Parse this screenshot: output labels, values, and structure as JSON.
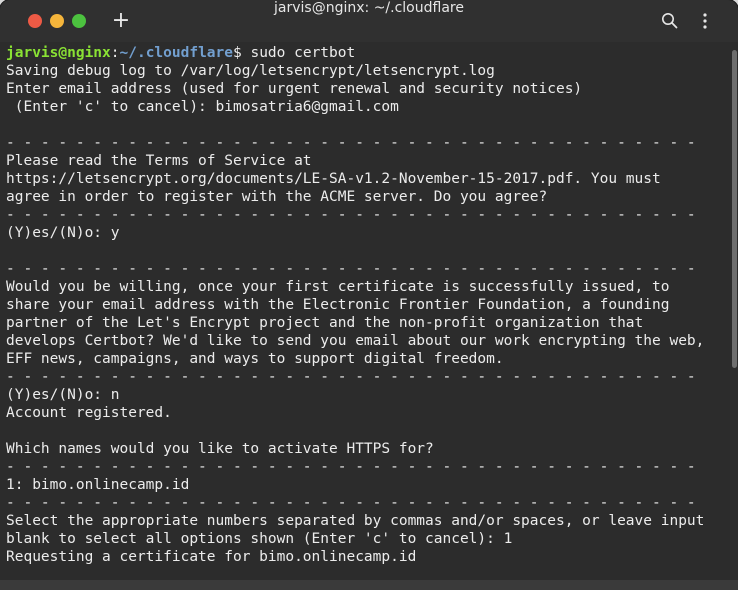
{
  "window": {
    "title": "jarvis@nginx: ~/.cloudflare",
    "new_tab_icon": "plus-icon",
    "search_icon": "search-icon",
    "menu_icon": "kebab-menu-icon"
  },
  "terminal": {
    "prompt_user": "jarvis@nginx",
    "prompt_sep": ":",
    "prompt_path": "~/.cloudflare",
    "prompt_end": "$ ",
    "command": "sudo certbot",
    "lines": [
      "Saving debug log to /var/log/letsencrypt/letsencrypt.log",
      "Enter email address (used for urgent renewal and security notices)",
      " (Enter 'c' to cancel): bimosatria6@gmail.com",
      "",
      "- - - - - - - - - - - - - - - - - - - - - - - - - - - - - - - - - - - - - - - -",
      "Please read the Terms of Service at",
      "https://letsencrypt.org/documents/LE-SA-v1.2-November-15-2017.pdf. You must",
      "agree in order to register with the ACME server. Do you agree?",
      "- - - - - - - - - - - - - - - - - - - - - - - - - - - - - - - - - - - - - - - -",
      "(Y)es/(N)o: y",
      "",
      "- - - - - - - - - - - - - - - - - - - - - - - - - - - - - - - - - - - - - - - -",
      "Would you be willing, once your first certificate is successfully issued, to",
      "share your email address with the Electronic Frontier Foundation, a founding",
      "partner of the Let's Encrypt project and the non-profit organization that",
      "develops Certbot? We'd like to send you email about our work encrypting the web,",
      "EFF news, campaigns, and ways to support digital freedom.",
      "- - - - - - - - - - - - - - - - - - - - - - - - - - - - - - - - - - - - - - - -",
      "(Y)es/(N)o: n",
      "Account registered.",
      "",
      "Which names would you like to activate HTTPS for?",
      "- - - - - - - - - - - - - - - - - - - - - - - - - - - - - - - - - - - - - - - -",
      "1: bimo.onlinecamp.id",
      "- - - - - - - - - - - - - - - - - - - - - - - - - - - - - - - - - - - - - - - -",
      "Select the appropriate numbers separated by commas and/or spaces, or leave input",
      "blank to select all options shown (Enter 'c' to cancel): 1",
      "Requesting a certificate for bimo.onlinecamp.id"
    ]
  }
}
